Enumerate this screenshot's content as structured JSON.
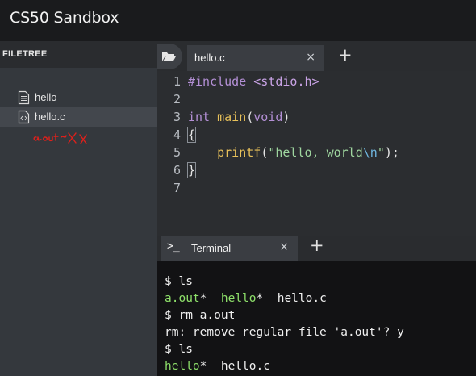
{
  "app": {
    "title": "CS50 Sandbox"
  },
  "sidebar": {
    "header": "FILETREE",
    "items": [
      {
        "label": "hello",
        "icon": "text-file-icon",
        "selected": false
      },
      {
        "label": "hello.c",
        "icon": "code-file-icon",
        "selected": true
      }
    ],
    "annotation": {
      "text": "a.out ✗",
      "color": "#e0201b"
    }
  },
  "editor": {
    "tab": {
      "label": "hello.c",
      "close": "×"
    },
    "add_tab": "+",
    "line_numbers": [
      "1",
      "2",
      "3",
      "4",
      "5",
      "6",
      "7"
    ],
    "code": {
      "l1": {
        "directive": "#include",
        "header": "<stdio.h>"
      },
      "l3": {
        "type": "int",
        "name": "main",
        "open": "(",
        "arg": "void",
        "close": ")"
      },
      "l4": "{",
      "l5": {
        "fn": "printf",
        "open": "(",
        "str": "\"hello, world",
        "esc": "\\n",
        "str_end": "\"",
        "close": ");"
      },
      "l6": "}"
    }
  },
  "terminal": {
    "tab": {
      "icon": ">_",
      "label": "Terminal",
      "close": "×"
    },
    "add_tab": "+",
    "lines": {
      "l1": "$ ls",
      "l2": {
        "f1": "a.out",
        "s1": "*  ",
        "f2": "hello",
        "s2": "*  ",
        "f3": "hello.c"
      },
      "l3": "$ rm a.out",
      "l4": "rm: remove regular file 'a.out'? y",
      "l5": "$ ls",
      "l6": {
        "f1": "hello",
        "s1": "*  ",
        "f2": "hello.c"
      }
    }
  },
  "colors": {
    "accent_green": "#8ee06a",
    "keyword": "#b490d6",
    "function": "#e8c15a",
    "string": "#9fd69f"
  }
}
